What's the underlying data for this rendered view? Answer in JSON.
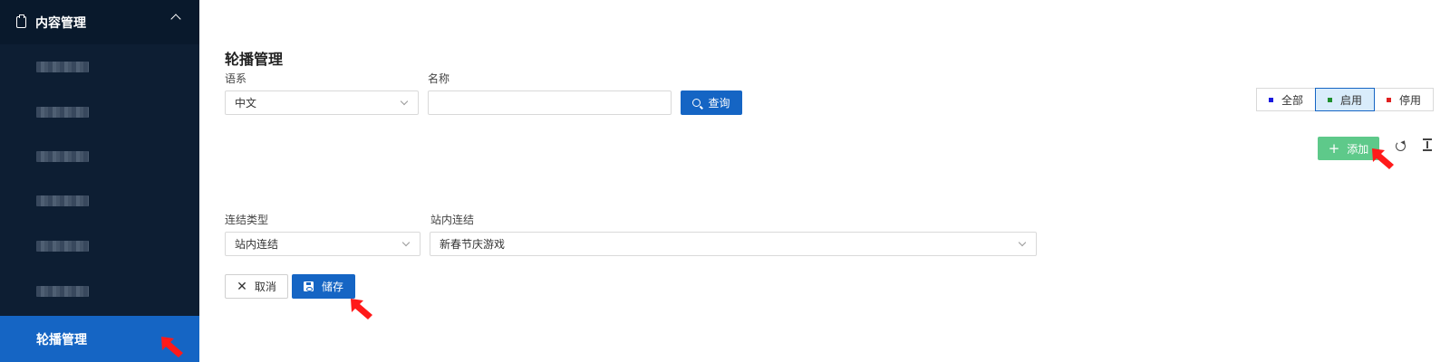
{
  "sidebar": {
    "header": "内容管理",
    "active_item": "轮播管理"
  },
  "page": {
    "title": "轮播管理"
  },
  "filters": {
    "language_label": "语系",
    "language_value": "中文",
    "name_label": "名称",
    "name_value": "",
    "search_button": "查询"
  },
  "status_filter": {
    "options": [
      "全部",
      "启用",
      "停用"
    ],
    "selected": "启用",
    "colors": [
      "#1a1adf",
      "#1e8f2e",
      "#e02020"
    ]
  },
  "toolbar": {
    "add_button": "添加"
  },
  "form": {
    "link_type_label": "连结类型",
    "link_type_value": "站内连结",
    "internal_link_label": "站内连结",
    "internal_link_value": "新春节庆游戏",
    "cancel_button": "取消",
    "save_button": "储存"
  },
  "accent_colors": {
    "primary": "#1565c4",
    "add": "#5ec98a",
    "sidebar": "#0d1e33",
    "pointer": "#ff1a1a"
  }
}
